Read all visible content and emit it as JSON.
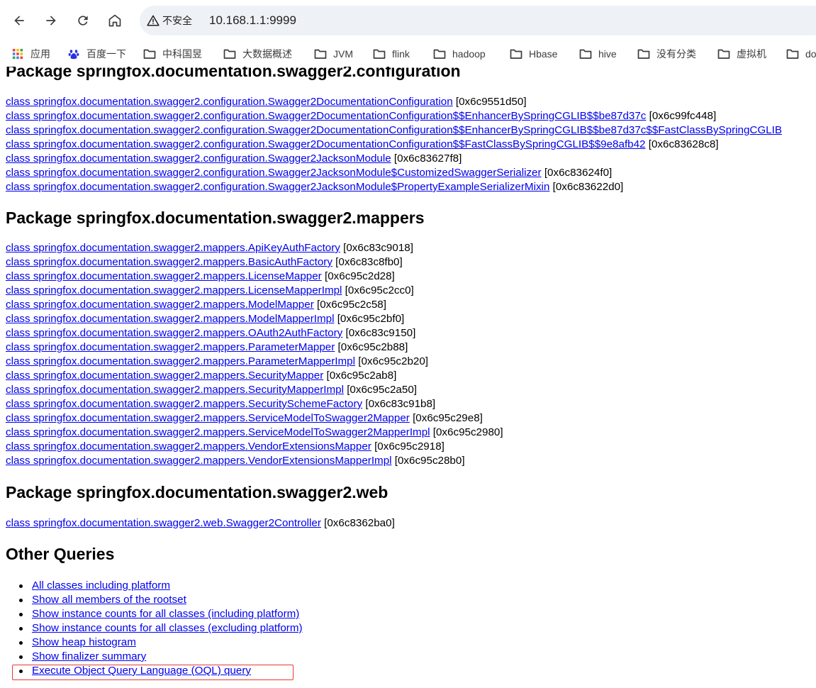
{
  "browser": {
    "security_label": "不安全",
    "url": "10.168.1.1:9999",
    "bookmarks": [
      {
        "label": "应用",
        "icon": "apps-grid-icon"
      },
      {
        "label": "百度一下",
        "icon": "baidu-paw-icon"
      },
      {
        "label": "中科国昱",
        "icon": "folder-icon"
      },
      {
        "label": "大数据概述",
        "icon": "folder-icon"
      },
      {
        "label": "JVM",
        "icon": "folder-icon"
      },
      {
        "label": "flink",
        "icon": "folder-icon"
      },
      {
        "label": "hadoop",
        "icon": "folder-icon"
      },
      {
        "label": "Hbase",
        "icon": "folder-icon"
      },
      {
        "label": "hive",
        "icon": "folder-icon"
      },
      {
        "label": "没有分类",
        "icon": "folder-icon"
      },
      {
        "label": "虚拟机",
        "icon": "folder-icon"
      },
      {
        "label": "do",
        "icon": "folder-icon"
      }
    ]
  },
  "colors": {
    "link": "#0000ee",
    "highlight": "#e53935"
  },
  "sections": [
    {
      "heading": "Package springfox.documentation.swagger2.configuration",
      "classes": [
        {
          "link": "class springfox.documentation.swagger2.configuration.Swagger2DocumentationConfiguration",
          "addr": "[0x6c9551d50]"
        },
        {
          "link": "class springfox.documentation.swagger2.configuration.Swagger2DocumentationConfiguration$$EnhancerBySpringCGLIB$$be87d37c",
          "addr": "[0x6c99fc448]"
        },
        {
          "link": "class springfox.documentation.swagger2.configuration.Swagger2DocumentationConfiguration$$EnhancerBySpringCGLIB$$be87d37c$$FastClassBySpringCGLIB",
          "addr": ""
        },
        {
          "link": "class springfox.documentation.swagger2.configuration.Swagger2DocumentationConfiguration$$FastClassBySpringCGLIB$$9e8afb42",
          "addr": "[0x6c83628c8]"
        },
        {
          "link": "class springfox.documentation.swagger2.configuration.Swagger2JacksonModule",
          "addr": "[0x6c83627f8]"
        },
        {
          "link": "class springfox.documentation.swagger2.configuration.Swagger2JacksonModule$CustomizedSwaggerSerializer",
          "addr": "[0x6c83624f0]"
        },
        {
          "link": "class springfox.documentation.swagger2.configuration.Swagger2JacksonModule$PropertyExampleSerializerMixin",
          "addr": "[0x6c83622d0]"
        }
      ]
    },
    {
      "heading": "Package springfox.documentation.swagger2.mappers",
      "classes": [
        {
          "link": "class springfox.documentation.swagger2.mappers.ApiKeyAuthFactory",
          "addr": "[0x6c83c9018]"
        },
        {
          "link": "class springfox.documentation.swagger2.mappers.BasicAuthFactory",
          "addr": "[0x6c83c8fb0]"
        },
        {
          "link": "class springfox.documentation.swagger2.mappers.LicenseMapper",
          "addr": "[0x6c95c2d28]"
        },
        {
          "link": "class springfox.documentation.swagger2.mappers.LicenseMapperImpl",
          "addr": "[0x6c95c2cc0]"
        },
        {
          "link": "class springfox.documentation.swagger2.mappers.ModelMapper",
          "addr": "[0x6c95c2c58]"
        },
        {
          "link": "class springfox.documentation.swagger2.mappers.ModelMapperImpl",
          "addr": "[0x6c95c2bf0]"
        },
        {
          "link": "class springfox.documentation.swagger2.mappers.OAuth2AuthFactory",
          "addr": "[0x6c83c9150]"
        },
        {
          "link": "class springfox.documentation.swagger2.mappers.ParameterMapper",
          "addr": "[0x6c95c2b88]"
        },
        {
          "link": "class springfox.documentation.swagger2.mappers.ParameterMapperImpl",
          "addr": "[0x6c95c2b20]"
        },
        {
          "link": "class springfox.documentation.swagger2.mappers.SecurityMapper",
          "addr": "[0x6c95c2ab8]"
        },
        {
          "link": "class springfox.documentation.swagger2.mappers.SecurityMapperImpl",
          "addr": "[0x6c95c2a50]"
        },
        {
          "link": "class springfox.documentation.swagger2.mappers.SecuritySchemeFactory",
          "addr": "[0x6c83c91b8]"
        },
        {
          "link": "class springfox.documentation.swagger2.mappers.ServiceModelToSwagger2Mapper",
          "addr": "[0x6c95c29e8]"
        },
        {
          "link": "class springfox.documentation.swagger2.mappers.ServiceModelToSwagger2MapperImpl",
          "addr": "[0x6c95c2980]"
        },
        {
          "link": "class springfox.documentation.swagger2.mappers.VendorExtensionsMapper",
          "addr": "[0x6c95c2918]"
        },
        {
          "link": "class springfox.documentation.swagger2.mappers.VendorExtensionsMapperImpl",
          "addr": "[0x6c95c28b0]"
        }
      ]
    },
    {
      "heading": "Package springfox.documentation.swagger2.web",
      "classes": [
        {
          "link": "class springfox.documentation.swagger2.web.Swagger2Controller",
          "addr": "[0x6c8362ba0]"
        }
      ]
    }
  ],
  "other_queries": {
    "heading": "Other Queries",
    "items": [
      "All classes including platform",
      "Show all members of the rootset",
      "Show instance counts for all classes (including platform)",
      "Show instance counts for all classes (excluding platform)",
      "Show heap histogram",
      "Show finalizer summary",
      "Execute Object Query Language (OQL) query"
    ],
    "highlighted_index": 6
  }
}
